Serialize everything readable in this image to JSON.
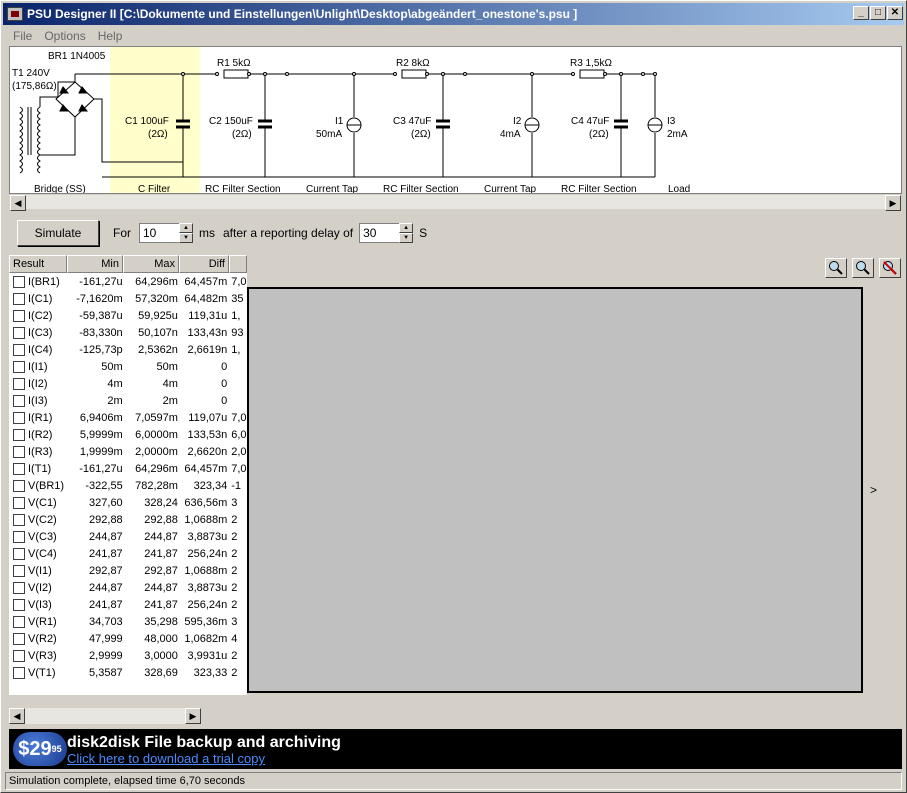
{
  "window": {
    "title": "PSU Designer II  [C:\\Dokumente und Einstellungen\\Unlight\\Desktop\\abgeändert_onestone's.psu ]"
  },
  "menu": [
    "File",
    "Options",
    "Help"
  ],
  "schematic": {
    "transformer": [
      "T1 240V",
      "(175,86Ω)"
    ],
    "bridge_label": "BR1 1N4005",
    "sections": [
      "Bridge (SS)",
      "C Filter",
      "RC Filter Section",
      "Current Tap",
      "RC Filter Section",
      "Current Tap",
      "RC Filter Section",
      "Load"
    ],
    "components": {
      "c1": [
        "C1 100uF",
        "(2Ω)"
      ],
      "c2": [
        "C2 150uF",
        "(2Ω)"
      ],
      "r1": "R1 5kΩ",
      "i1": [
        "I1",
        "50mA"
      ],
      "r2": "R2 8kΩ",
      "c3": [
        "C3 47uF",
        "(2Ω)"
      ],
      "i2": [
        "I2",
        "4mA"
      ],
      "r3": "R3 1,5kΩ",
      "c4": [
        "C4 47uF",
        "(2Ω)"
      ],
      "i3": [
        "I3",
        "2mA"
      ]
    },
    "highlight_color": "#ffffcc"
  },
  "simulate": {
    "button": "Simulate",
    "for_label": "For",
    "for_value": "10",
    "ms_label": "ms",
    "delay_label": "after a reporting delay of",
    "delay_value": "30",
    "s_label": "S"
  },
  "results": {
    "headers": [
      "Result",
      "Min",
      "Max",
      "Diff"
    ],
    "rows": [
      [
        "I(BR1)",
        "-161,27u",
        "64,296m",
        "64,457m",
        "7,0"
      ],
      [
        "I(C1)",
        "-7,1620m",
        "57,320m",
        "64,482m",
        "35"
      ],
      [
        "I(C2)",
        "-59,387u",
        "59,925u",
        "119,31u",
        "1,"
      ],
      [
        "I(C3)",
        "-83,330n",
        "50,107n",
        "133,43n",
        "93"
      ],
      [
        "I(C4)",
        "-125,73p",
        "2,5362n",
        "2,6619n",
        "1,"
      ],
      [
        "I(I1)",
        "50m",
        "50m",
        "0",
        ""
      ],
      [
        "I(I2)",
        "4m",
        "4m",
        "0",
        ""
      ],
      [
        "I(I3)",
        "2m",
        "2m",
        "0",
        ""
      ],
      [
        "I(R1)",
        "6,9406m",
        "7,0597m",
        "119,07u",
        "7,0"
      ],
      [
        "I(R2)",
        "5,9999m",
        "6,0000m",
        "133,53n",
        "6,0"
      ],
      [
        "I(R3)",
        "1,9999m",
        "2,0000m",
        "2,6620n",
        "2,0"
      ],
      [
        "I(T1)",
        "-161,27u",
        "64,296m",
        "64,457m",
        "7,0"
      ],
      [
        "V(BR1)",
        "-322,55",
        "782,28m",
        "323,34",
        "-1"
      ],
      [
        "V(C1)",
        "327,60",
        "328,24",
        "636,56m",
        "3"
      ],
      [
        "V(C2)",
        "292,88",
        "292,88",
        "1,0688m",
        "2"
      ],
      [
        "V(C3)",
        "244,87",
        "244,87",
        "3,8873u",
        "2"
      ],
      [
        "V(C4)",
        "241,87",
        "241,87",
        "256,24n",
        "2"
      ],
      [
        "V(I1)",
        "292,87",
        "292,87",
        "1,0688m",
        "2"
      ],
      [
        "V(I2)",
        "244,87",
        "244,87",
        "3,8873u",
        "2"
      ],
      [
        "V(I3)",
        "241,87",
        "241,87",
        "256,24n",
        "2"
      ],
      [
        "V(R1)",
        "34,703",
        "35,298",
        "595,36m",
        "3"
      ],
      [
        "V(R2)",
        "47,999",
        "48,000",
        "1,0682m",
        "4"
      ],
      [
        "V(R3)",
        "2,9999",
        "3,0000",
        "3,9931u",
        "2"
      ],
      [
        "V(T1)",
        "5,3587",
        "328,69",
        "323,33",
        "2"
      ]
    ]
  },
  "graph": {
    "arrow": ">"
  },
  "banner": {
    "price": "$29",
    "price_cents": "95",
    "title": "disk2disk File backup and archiving",
    "link": "Click here to download a trial copy"
  },
  "status": "Simulation complete, elapsed time 6,70 seconds"
}
